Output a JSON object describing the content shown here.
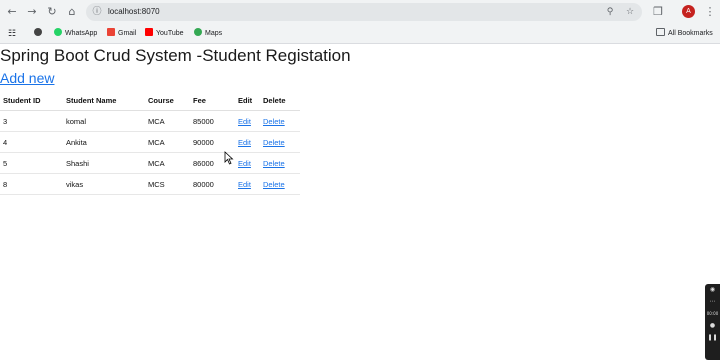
{
  "browser": {
    "url": "localhost:8070",
    "avatar_letter": "A",
    "bookmarks": [
      "WhatsApp",
      "Gmail",
      "YouTube",
      "Maps"
    ],
    "all_bookmarks_label": "All Bookmarks"
  },
  "page": {
    "title": "Spring Boot Crud System -Student Registation",
    "add_new_label": "Add new",
    "table": {
      "headers": [
        "Student ID",
        "Student Name",
        "Course",
        "Fee",
        "Edit",
        "Delete"
      ],
      "rows": [
        [
          "3",
          "komal",
          "MCA",
          "85000",
          "Edit",
          "Delete"
        ],
        [
          "4",
          "Ankita",
          "MCA",
          "90000",
          "Edit",
          "Delete"
        ],
        [
          "5",
          "Shashi",
          "MCA",
          "86000",
          "Edit",
          "Delete"
        ],
        [
          "8",
          "vikas",
          "MCS",
          "80000",
          "Edit",
          "Delete"
        ]
      ]
    }
  },
  "side_widget": {
    "timer": "00:00"
  },
  "colors": {
    "link": "#1a73e8",
    "chrome_bg": "#f1f3f4",
    "avatar": "#c5221f"
  }
}
